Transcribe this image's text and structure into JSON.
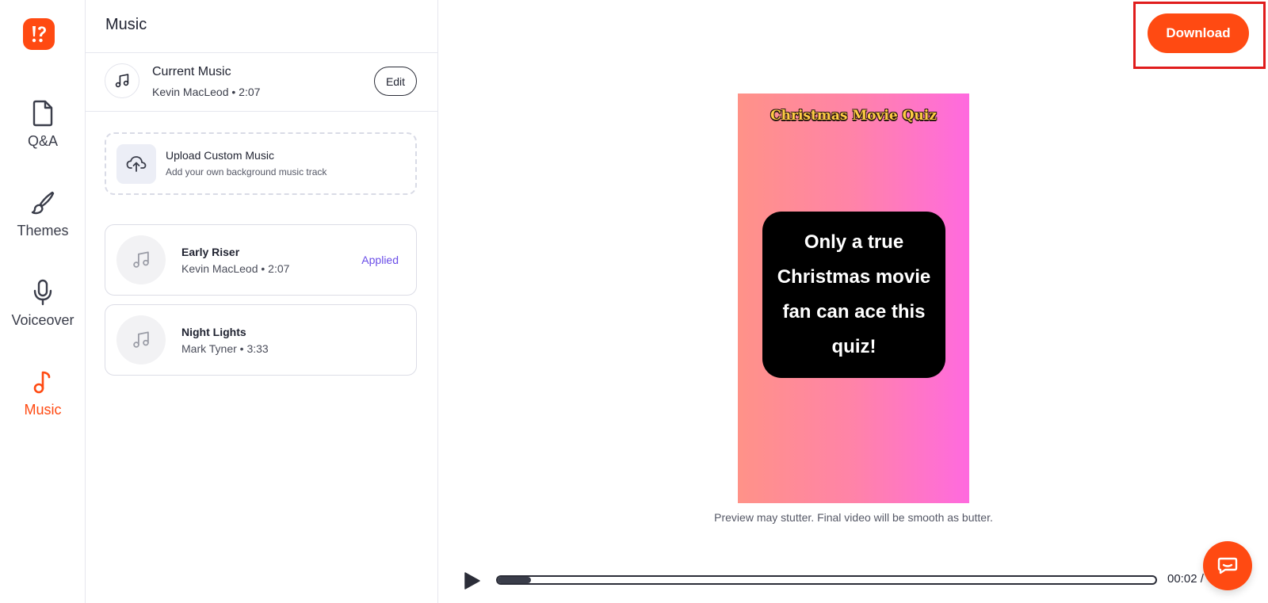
{
  "nav": {
    "items": [
      {
        "label": "Q&A",
        "icon": "document-icon",
        "active": false
      },
      {
        "label": "Themes",
        "icon": "brush-icon",
        "active": false
      },
      {
        "label": "Voiceover",
        "icon": "microphone-icon",
        "active": false
      },
      {
        "label": "Music",
        "icon": "music-note-icon",
        "active": true
      }
    ]
  },
  "panel": {
    "title": "Music",
    "current": {
      "title": "Current Music",
      "subtitle": "Kevin MacLeod • 2:07",
      "edit_label": "Edit"
    },
    "upload": {
      "title": "Upload Custom Music",
      "subtitle": "Add your own background music track"
    },
    "tracks": [
      {
        "title": "Early Riser",
        "subtitle": "Kevin MacLeod • 2:07",
        "status": "Applied"
      },
      {
        "title": "Night Lights",
        "subtitle": "Mark Tyner • 3:33",
        "status": ""
      }
    ]
  },
  "header": {
    "download_label": "Download"
  },
  "video": {
    "title": "Christmas Movie Quiz",
    "card_text": "Only a true Christmas movie fan can ace this quiz!"
  },
  "preview_note": "Preview may stutter. Final video will be smooth as butter.",
  "player": {
    "time": "00:02 /",
    "progress": 0.05
  },
  "colors": {
    "accent": "#ff4a12",
    "applied": "#6a4de8",
    "highlight": "#e01c1c"
  }
}
